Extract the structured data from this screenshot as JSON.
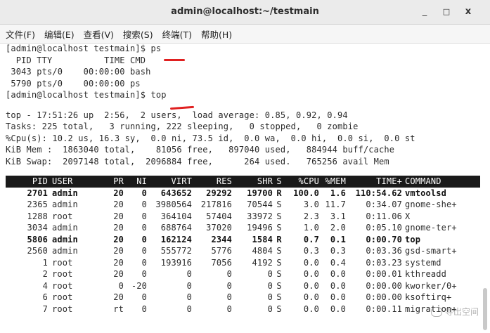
{
  "window": {
    "title": "admin@localhost:~/testmain",
    "min": "_",
    "max": "□",
    "close": "x"
  },
  "menu": [
    "文件(F)",
    "编辑(E)",
    "查看(V)",
    "搜索(S)",
    "终端(T)",
    "帮助(H)"
  ],
  "ps_block": [
    "[admin@localhost testmain]$ ps",
    "  PID TTY          TIME CMD",
    " 3043 pts/0    00:00:00 bash",
    " 5790 pts/0    00:00:00 ps",
    "[admin@localhost testmain]$ top"
  ],
  "summary": [
    "top - 17:51:26 up  2:56,  2 users,  load average: 0.85, 0.92, 0.94",
    "Tasks: 225 total,   3 running, 222 sleeping,   0 stopped,   0 zombie",
    "%Cpu(s): 10.2 us, 16.3 sy,  0.0 ni, 73.5 id,  0.0 wa,  0.0 hi,  0.0 si,  0.0 st",
    "KiB Mem :  1863040 total,    81056 free,   897040 used,   884944 buff/cache",
    "KiB Swap:  2097148 total,  2096884 free,      264 used.   765256 avail Mem"
  ],
  "table": {
    "headers": [
      "PID",
      "USER",
      "PR",
      "NI",
      "VIRT",
      "RES",
      "SHR",
      "S",
      "%CPU",
      "%MEM",
      "TIME+",
      "COMMAND"
    ],
    "rows": [
      {
        "bold": true,
        "cells": [
          "2701",
          "admin",
          "20",
          "0",
          "643652",
          "29292",
          "19700",
          "R",
          "100.0",
          "1.6",
          "110:54.62",
          "vmtoolsd"
        ]
      },
      {
        "bold": false,
        "cells": [
          "2365",
          "admin",
          "20",
          "0",
          "3980564",
          "217816",
          "70544",
          "S",
          "3.0",
          "11.7",
          "0:34.07",
          "gnome-she+"
        ]
      },
      {
        "bold": false,
        "cells": [
          "1288",
          "root",
          "20",
          "0",
          "364104",
          "57404",
          "33972",
          "S",
          "2.3",
          "3.1",
          "0:11.06",
          "X"
        ]
      },
      {
        "bold": false,
        "cells": [
          "3034",
          "admin",
          "20",
          "0",
          "688764",
          "37020",
          "19496",
          "S",
          "1.0",
          "2.0",
          "0:05.10",
          "gnome-ter+"
        ]
      },
      {
        "bold": true,
        "cells": [
          "5806",
          "admin",
          "20",
          "0",
          "162124",
          "2344",
          "1584",
          "R",
          "0.7",
          "0.1",
          "0:00.70",
          "top"
        ]
      },
      {
        "bold": false,
        "cells": [
          "2560",
          "admin",
          "20",
          "0",
          "555772",
          "5776",
          "4804",
          "S",
          "0.3",
          "0.3",
          "0:03.36",
          "gsd-smart+"
        ]
      },
      {
        "bold": false,
        "cells": [
          "1",
          "root",
          "20",
          "0",
          "193916",
          "7056",
          "4192",
          "S",
          "0.0",
          "0.4",
          "0:03.23",
          "systemd"
        ]
      },
      {
        "bold": false,
        "cells": [
          "2",
          "root",
          "20",
          "0",
          "0",
          "0",
          "0",
          "S",
          "0.0",
          "0.0",
          "0:00.01",
          "kthreadd"
        ]
      },
      {
        "bold": false,
        "cells": [
          "4",
          "root",
          "0",
          "-20",
          "0",
          "0",
          "0",
          "S",
          "0.0",
          "0.0",
          "0:00.00",
          "kworker/0+"
        ]
      },
      {
        "bold": false,
        "cells": [
          "6",
          "root",
          "20",
          "0",
          "0",
          "0",
          "0",
          "S",
          "0.0",
          "0.0",
          "0:00.00",
          "ksoftirq+"
        ]
      },
      {
        "bold": false,
        "cells": [
          "7",
          "root",
          "rt",
          "0",
          "0",
          "0",
          "0",
          "S",
          "0.0",
          "0.0",
          "0:00.11",
          "migration+"
        ]
      }
    ]
  },
  "watermark": "导出空间"
}
